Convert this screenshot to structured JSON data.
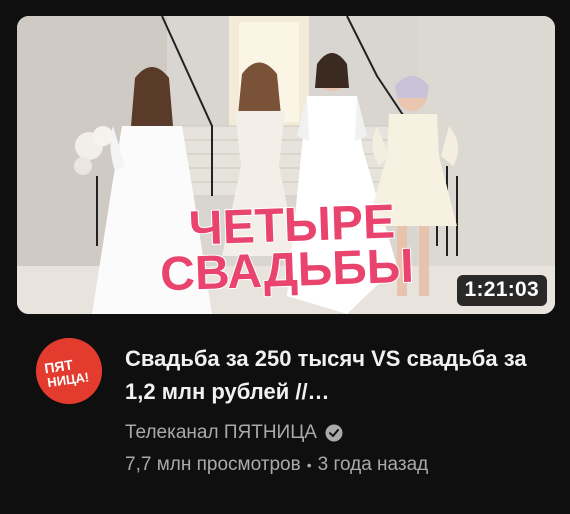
{
  "video": {
    "thumbnail": {
      "overlay_line1": "ЧЕТЫРЕ",
      "overlay_line2": "СВАДЬБЫ",
      "overlay_color": "#e8446e",
      "duration": "1:21:03"
    },
    "title": "Свадьба за 250 тысяч VS свадьба за 1,2 млн рублей //…",
    "channel": {
      "name": "Телеканал ПЯТНИЦА",
      "verified_icon": "verified-check-icon",
      "avatar_line1": "ПЯТ",
      "avatar_line2": "НИЦА!",
      "avatar_color": "#e43b2f"
    },
    "views": "7,7 млн просмотров",
    "separator": "•",
    "published": "3 года назад"
  }
}
